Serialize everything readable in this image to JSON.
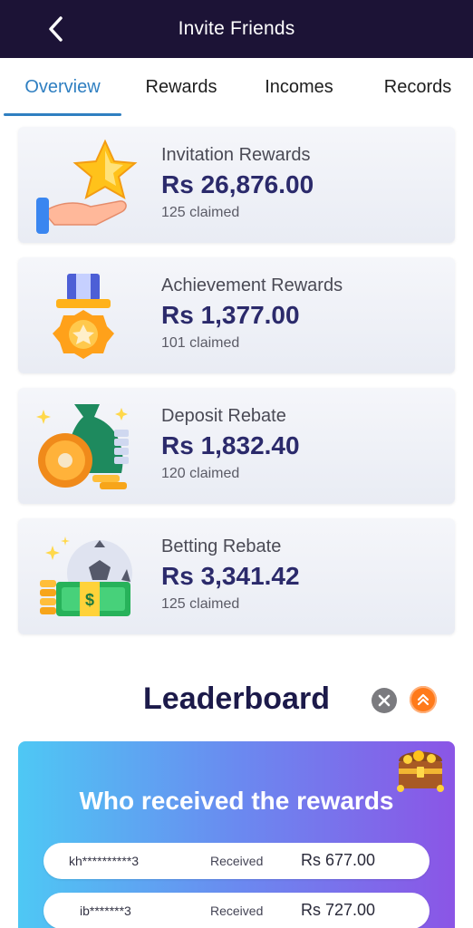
{
  "header": {
    "title": "Invite Friends",
    "back_icon": "chevron-left-icon"
  },
  "tabs": [
    {
      "label": "Overview",
      "active": true
    },
    {
      "label": "Rewards",
      "active": false
    },
    {
      "label": "Incomes",
      "active": false
    },
    {
      "label": "Records",
      "active": false
    }
  ],
  "cards": [
    {
      "title": "Invitation Rewards",
      "amount": "Rs 26,876.00",
      "claimed": "125 claimed",
      "icon": "hand-star-icon"
    },
    {
      "title": "Achievement Rewards",
      "amount": "Rs 1,377.00",
      "claimed": "101 claimed",
      "icon": "medal-icon"
    },
    {
      "title": "Deposit Rebate",
      "amount": "Rs 1,832.40",
      "claimed": "120 claimed",
      "icon": "money-bag-icon"
    },
    {
      "title": "Betting Rebate",
      "amount": "Rs 3,341.42",
      "claimed": "125 claimed",
      "icon": "soccer-cash-icon"
    }
  ],
  "leaderboard": {
    "title": "Leaderboard",
    "panel_title": "Who received the rewards",
    "rows": [
      {
        "user": "kh**********3",
        "status": "Received",
        "amount": "Rs 677.00"
      },
      {
        "user": "ib*******3",
        "status": "Received",
        "amount": "Rs 727.00"
      }
    ]
  },
  "colors": {
    "header_bg": "#1c1336",
    "active_tab": "#2f7fc1",
    "amount_text": "#2b2a6b",
    "close_button": "#7b7b7f",
    "scroll_top_button": "#ff7a1a"
  }
}
